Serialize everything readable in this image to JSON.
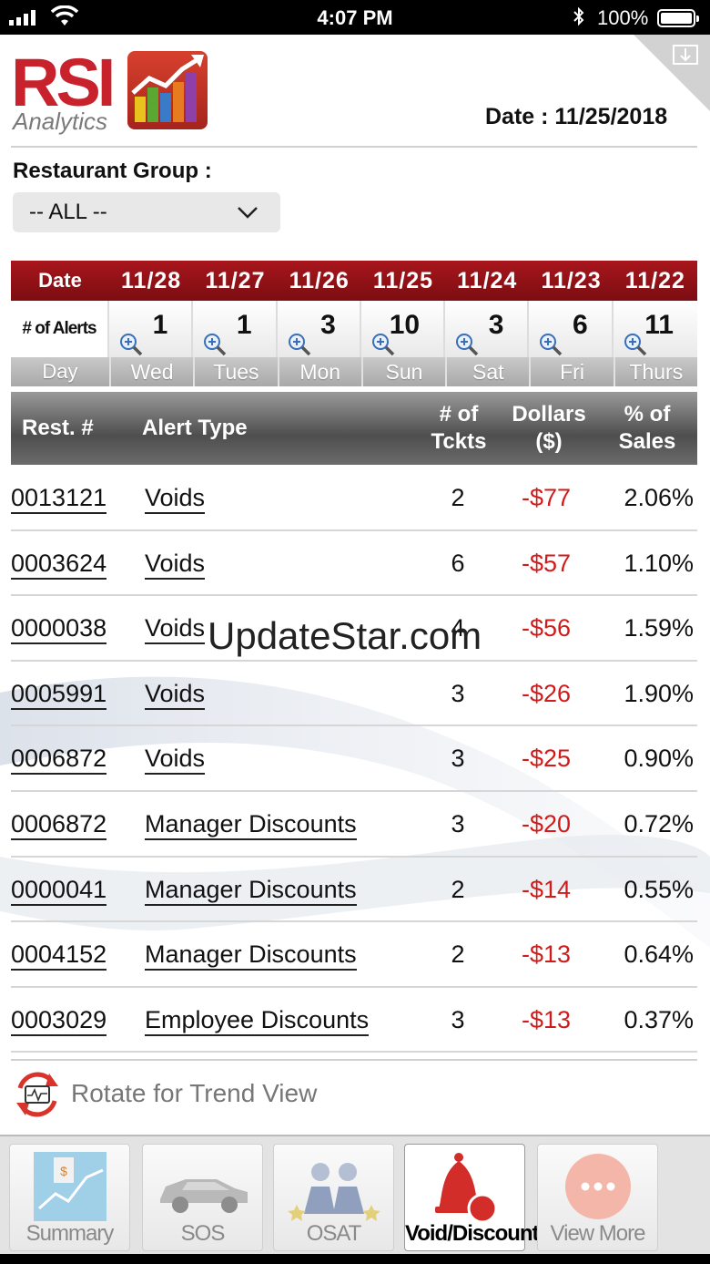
{
  "status_bar": {
    "time": "4:07 PM",
    "battery_percent": "100%",
    "bluetooth_icon": "bluetooth-icon"
  },
  "header": {
    "logo_main": "RSI",
    "logo_sub": "Analytics",
    "date_text": "Date : 11/25/2018"
  },
  "filter": {
    "label": "Restaurant Group :",
    "selected": "-- ALL --"
  },
  "alert_strip": {
    "date_header": "Date",
    "alerts_header": "# of Alerts",
    "day_header": "Day",
    "days": [
      {
        "date": "11/28",
        "alerts": "1",
        "day": "Wed"
      },
      {
        "date": "11/27",
        "alerts": "1",
        "day": "Tues"
      },
      {
        "date": "11/26",
        "alerts": "3",
        "day": "Mon"
      },
      {
        "date": "11/25",
        "alerts": "10",
        "day": "Sun"
      },
      {
        "date": "11/24",
        "alerts": "3",
        "day": "Sat"
      },
      {
        "date": "11/23",
        "alerts": "6",
        "day": "Fri"
      },
      {
        "date": "11/22",
        "alerts": "11",
        "day": "Thurs"
      }
    ]
  },
  "table": {
    "headers": {
      "rest": "Rest. #",
      "type": "Alert Type",
      "tickets_1": "# of",
      "tickets_2": "Tckts",
      "dollars_1": "Dollars",
      "dollars_2": "($)",
      "pct_1": "% of",
      "pct_2": "Sales"
    },
    "rows": [
      {
        "rest": "0013121",
        "type": "Voids",
        "tickets": "2",
        "dollars": "-$77",
        "pct": "2.06%"
      },
      {
        "rest": "0003624",
        "type": "Voids",
        "tickets": "6",
        "dollars": "-$57",
        "pct": "1.10%"
      },
      {
        "rest": "0000038",
        "type": "Voids",
        "tickets": "4",
        "dollars": "-$56",
        "pct": "1.59%"
      },
      {
        "rest": "0005991",
        "type": "Voids",
        "tickets": "3",
        "dollars": "-$26",
        "pct": "1.90%"
      },
      {
        "rest": "0006872",
        "type": "Voids",
        "tickets": "3",
        "dollars": "-$25",
        "pct": "0.90%"
      },
      {
        "rest": "0006872",
        "type": "Manager Discounts",
        "tickets": "3",
        "dollars": "-$20",
        "pct": "0.72%"
      },
      {
        "rest": "0000041",
        "type": "Manager Discounts",
        "tickets": "2",
        "dollars": "-$14",
        "pct": "0.55%"
      },
      {
        "rest": "0004152",
        "type": "Manager Discounts",
        "tickets": "2",
        "dollars": "-$13",
        "pct": "0.64%"
      },
      {
        "rest": "0003029",
        "type": "Employee Discounts",
        "tickets": "3",
        "dollars": "-$13",
        "pct": "0.37%"
      }
    ]
  },
  "watermark": "UpdateStar.com",
  "rotate_hint": "Rotate for Trend View",
  "tabs": [
    {
      "label": "Summary",
      "icon": "summary-chart-icon",
      "active": false
    },
    {
      "label": "SOS",
      "icon": "car-icon",
      "active": false
    },
    {
      "label": "OSAT",
      "icon": "people-icon",
      "active": false
    },
    {
      "label": "Void/Discount",
      "icon": "bell-icon",
      "active": true
    },
    {
      "label": "View More",
      "icon": "more-icon",
      "active": false
    }
  ],
  "colors": {
    "brand_red": "#c8232c",
    "date_strip": "#8e1015",
    "negative_value": "#d11b1b"
  }
}
